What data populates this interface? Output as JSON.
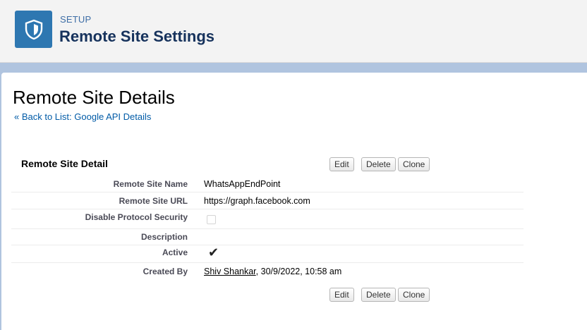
{
  "header": {
    "setup_label": "SETUP",
    "title": "Remote Site Settings",
    "icon": "shield-icon"
  },
  "page": {
    "title": "Remote Site Details",
    "back_prefix": "« ",
    "back_link": "Back to List: Google API Details"
  },
  "detail": {
    "section_title": "Remote Site Detail",
    "buttons": {
      "edit": "Edit",
      "delete": "Delete",
      "clone": "Clone"
    },
    "fields": {
      "name_label": "Remote Site Name",
      "name_value": "WhatsAppEndPoint",
      "url_label": "Remote Site URL",
      "url_value": "https://graph.facebook.com",
      "disable_label": "Disable Protocol Security",
      "disable_checked": false,
      "description_label": "Description",
      "description_value": "",
      "active_label": "Active",
      "active_checked": true,
      "created_by_label": "Created By",
      "created_by_user": "Shiv Shankar",
      "created_by_date": ", 30/9/2022, 10:58 am"
    }
  },
  "colors": {
    "brand": "#2e77b1",
    "link": "#015ba7",
    "background": "#b0c4df"
  }
}
